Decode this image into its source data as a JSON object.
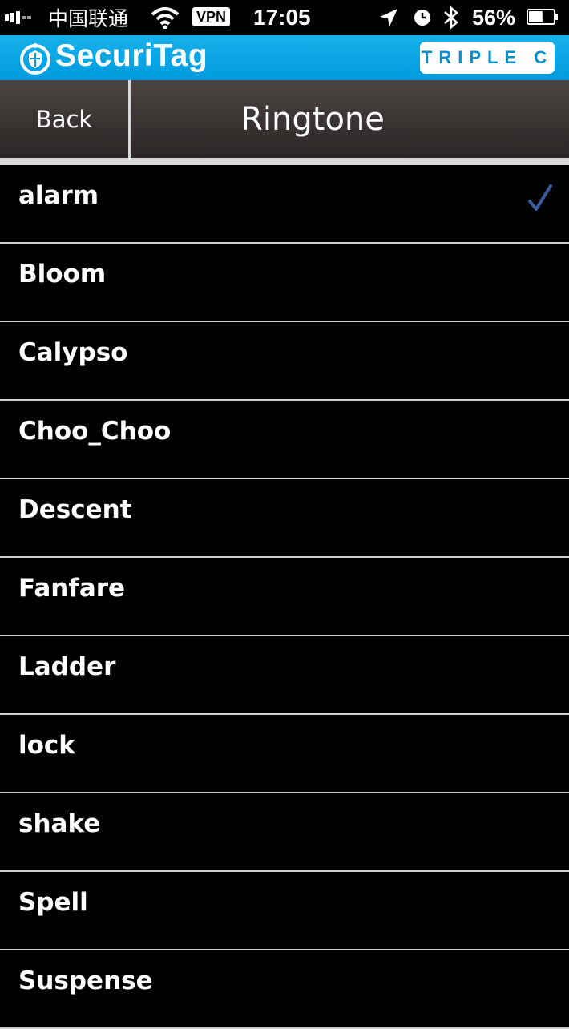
{
  "status_bar": {
    "carrier": "中国联通",
    "vpn": "VPN",
    "time": "17:05",
    "battery": "56%",
    "battery_level": 0.56
  },
  "app_header": {
    "brand": "SecuriTag",
    "partner": "TRIPLE C",
    "brand_color": "#00a0e0"
  },
  "nav": {
    "back_label": "Back",
    "title": "Ringtone"
  },
  "ringtones": [
    {
      "label": "alarm",
      "selected": true
    },
    {
      "label": "Bloom",
      "selected": false
    },
    {
      "label": "Calypso",
      "selected": false
    },
    {
      "label": "Choo_Choo",
      "selected": false
    },
    {
      "label": "Descent",
      "selected": false
    },
    {
      "label": "Fanfare",
      "selected": false
    },
    {
      "label": "Ladder",
      "selected": false
    },
    {
      "label": "lock",
      "selected": false
    },
    {
      "label": "shake",
      "selected": false
    },
    {
      "label": "Spell",
      "selected": false
    },
    {
      "label": "Suspense",
      "selected": false
    }
  ],
  "checkmark_color": "#3a5d9c"
}
